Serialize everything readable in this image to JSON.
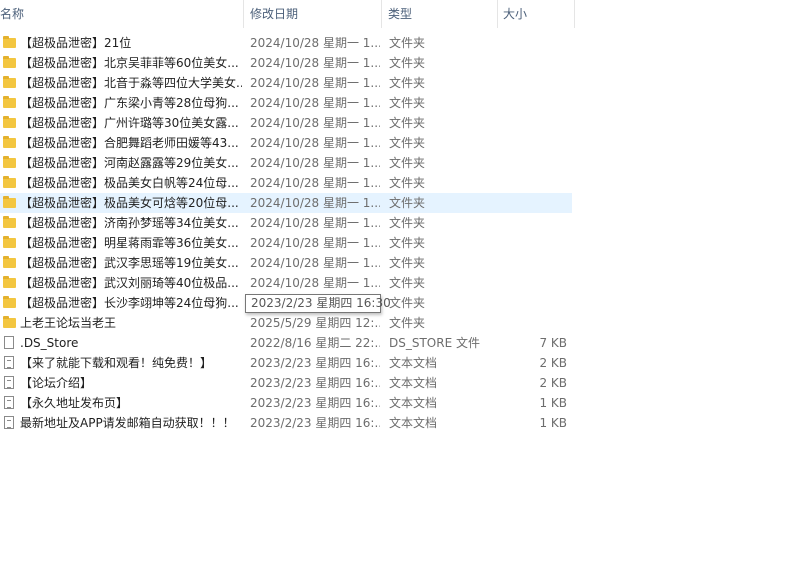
{
  "columns": {
    "name": "名称",
    "date": "修改日期",
    "type": "类型",
    "size": "大小"
  },
  "rows": [
    {
      "name": "【超极品泄密】21位",
      "date": "2024/10/28 星期一 1...",
      "type": "文件夹",
      "size": "",
      "icon": "folder"
    },
    {
      "name": "【超极品泄密】北京吴菲菲等60位美女...",
      "date": "2024/10/28 星期一 1...",
      "type": "文件夹",
      "size": "",
      "icon": "folder"
    },
    {
      "name": "【超极品泄密】北音于淼等四位大学美女...",
      "date": "2024/10/28 星期一 1...",
      "type": "文件夹",
      "size": "",
      "icon": "folder"
    },
    {
      "name": "【超极品泄密】广东梁小青等28位母狗...",
      "date": "2024/10/28 星期一 1...",
      "type": "文件夹",
      "size": "",
      "icon": "folder"
    },
    {
      "name": "【超极品泄密】广州许璐等30位美女露...",
      "date": "2024/10/28 星期一 1...",
      "type": "文件夹",
      "size": "",
      "icon": "folder"
    },
    {
      "name": "【超极品泄密】合肥舞蹈老师田媛等43...",
      "date": "2024/10/28 星期一 1...",
      "type": "文件夹",
      "size": "",
      "icon": "folder"
    },
    {
      "name": "【超极品泄密】河南赵露露等29位美女...",
      "date": "2024/10/28 星期一 1...",
      "type": "文件夹",
      "size": "",
      "icon": "folder"
    },
    {
      "name": "【超极品泄密】极品美女白帆等24位母...",
      "date": "2024/10/28 星期一 1...",
      "type": "文件夹",
      "size": "",
      "icon": "folder"
    },
    {
      "name": "【超极品泄密】极品美女可焓等20位母...",
      "date": "2024/10/28 星期一 1...",
      "type": "文件夹",
      "size": "",
      "icon": "folder",
      "hovered": true
    },
    {
      "name": "【超极品泄密】济南孙梦瑶等34位美女...",
      "date": "2024/10/28 星期一 1...",
      "type": "文件夹",
      "size": "",
      "icon": "folder"
    },
    {
      "name": "【超极品泄密】明星蒋雨霏等36位美女...",
      "date": "2024/10/28 星期一 1...",
      "type": "文件夹",
      "size": "",
      "icon": "folder"
    },
    {
      "name": "【超极品泄密】武汉李思瑶等19位美女...",
      "date": "2024/10/28 星期一 1...",
      "type": "文件夹",
      "size": "",
      "icon": "folder"
    },
    {
      "name": "【超极品泄密】武汉刘丽琦等40位极品...",
      "date": "2024/10/28 星期一 1...",
      "type": "文件夹",
      "size": "",
      "icon": "folder"
    },
    {
      "name": "【超极品泄密】长沙李翊坤等24位母狗...",
      "date": "",
      "type": "文件夹",
      "size": "",
      "icon": "folder"
    },
    {
      "name": "上老王论坛当老王",
      "date": "2025/5/29 星期四 12:...",
      "type": "文件夹",
      "size": "",
      "icon": "folder"
    },
    {
      "name": ".DS_Store",
      "date": "2022/8/16 星期二 22:...",
      "type": "DS_STORE 文件",
      "size": "7 KB",
      "icon": "file"
    },
    {
      "name": "【来了就能下载和观看！纯免费！】",
      "date": "2023/2/23 星期四 16:...",
      "type": "文本文档",
      "size": "2 KB",
      "icon": "text"
    },
    {
      "name": "【论坛介绍】",
      "date": "2023/2/23 星期四 16:...",
      "type": "文本文档",
      "size": "2 KB",
      "icon": "text"
    },
    {
      "name": "【永久地址发布页】",
      "date": "2023/2/23 星期四 16:...",
      "type": "文本文档",
      "size": "1 KB",
      "icon": "text"
    },
    {
      "name": "最新地址及APP请发邮箱自动获取！！！",
      "date": "2023/2/23 星期四 16:...",
      "type": "文本文档",
      "size": "1 KB",
      "icon": "text"
    }
  ],
  "tooltip": {
    "text": "2023/2/23 星期四 16:30"
  },
  "colors": {
    "folder": "#f3c640",
    "hover_row": "#e5f3ff",
    "header_text": "#4c607a"
  }
}
